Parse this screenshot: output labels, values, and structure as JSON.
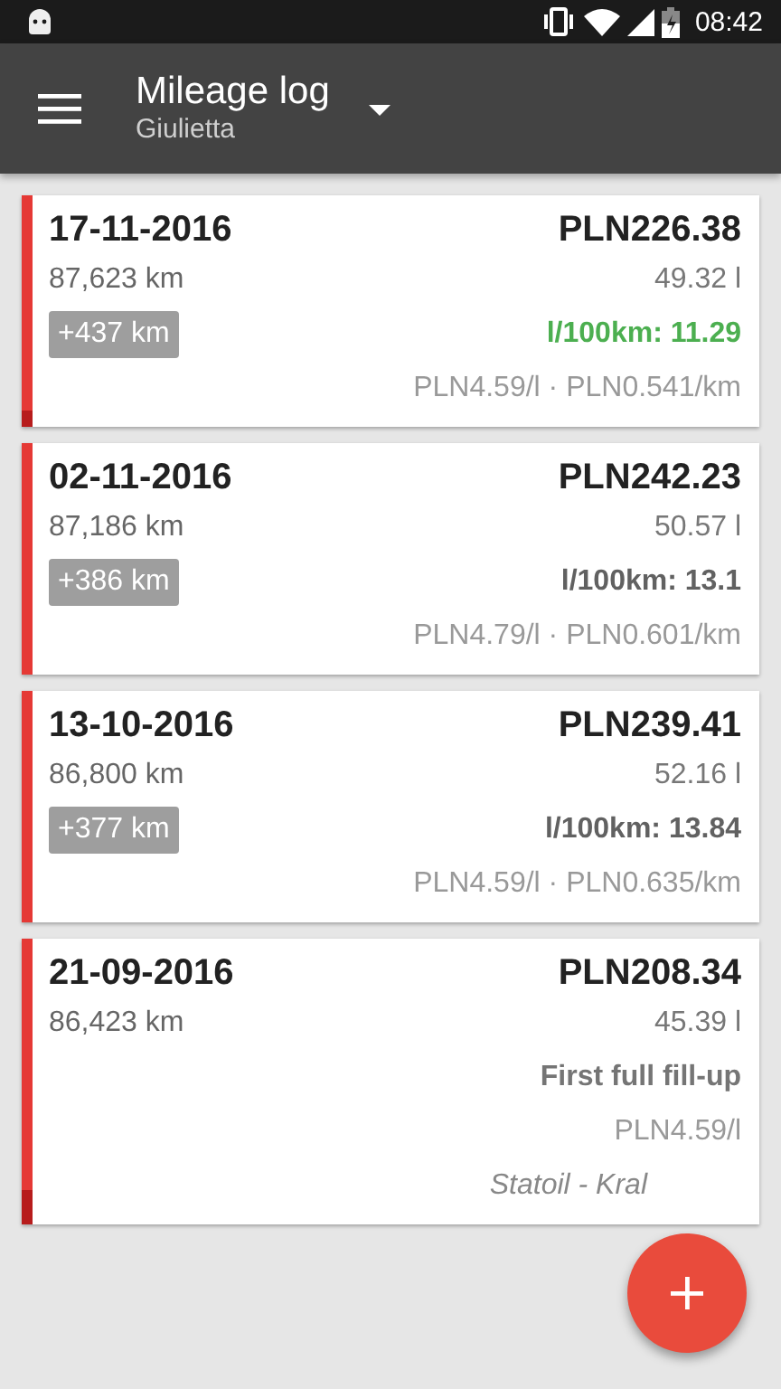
{
  "status_bar": {
    "time": "08:42"
  },
  "app_bar": {
    "title": "Mileage log",
    "subtitle": "Giulietta"
  },
  "entries": [
    {
      "date": "17-11-2016",
      "total": "PLN226.38",
      "odometer": "87,623 km",
      "volume": "49.32 l",
      "distance": "+437 km",
      "consumption": "l/100km: 11.29",
      "color": "#4caf50",
      "prices": "PLN4.59/l · PLN0.541/km",
      "level": 0.07
    },
    {
      "date": "02-11-2016",
      "total": "PLN242.23",
      "odometer": "87,186 km",
      "volume": "50.57 l",
      "distance": "+386 km",
      "consumption": "l/100km: 13.1",
      "color": "#616161",
      "prices": "PLN4.79/l · PLN0.601/km",
      "level": 0
    },
    {
      "date": "13-10-2016",
      "total": "PLN239.41",
      "odometer": "86,800 km",
      "volume": "52.16 l",
      "distance": "+377 km",
      "consumption": "l/100km: 13.84",
      "color": "#616161",
      "prices": "PLN4.59/l · PLN0.635/km",
      "level": 0
    },
    {
      "date": "21-09-2016",
      "total": "PLN208.34",
      "odometer": "86,423 km",
      "volume": "45.39 l",
      "consumption": "First full fill-up",
      "color": "#757575",
      "prices": "PLN4.59/l",
      "station": "Statoil - Kral",
      "level": 0.12
    }
  ]
}
